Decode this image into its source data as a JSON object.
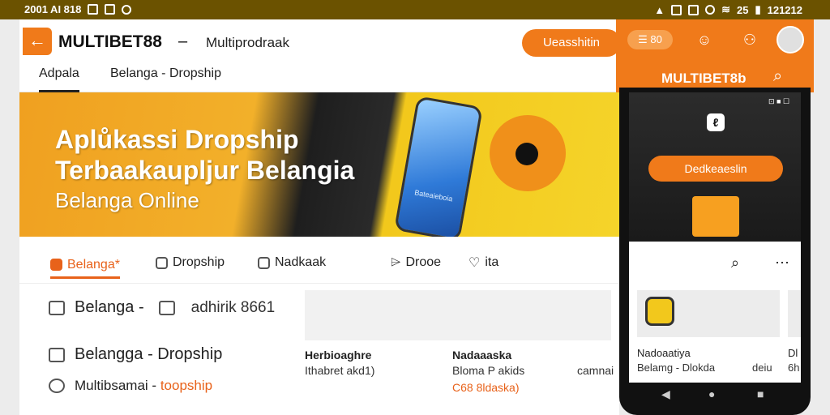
{
  "statusbar": {
    "left_text": "2001 AI 818",
    "right_text": "25",
    "time": "121212"
  },
  "header": {
    "back_label": "←",
    "brand": "MULTIBET88",
    "brand_sep": "–",
    "brand_sub": "Multiprodraak",
    "cta_label": "Ueasshitin",
    "tabs": [
      {
        "label": "Adpala"
      },
      {
        "label": "Belanga - Dropship"
      }
    ]
  },
  "hero": {
    "title_line1": "Aplůkassi Dropship",
    "title_line2": "Terbaakaupljur Belangia",
    "subtitle": "Belanga Online",
    "phone_label": "Bateaieboia"
  },
  "categories": [
    {
      "label": "Belanga*"
    },
    {
      "label": "Dropship"
    },
    {
      "label": "Nadkaak"
    },
    {
      "label": "Drooe"
    },
    {
      "label": "ita"
    }
  ],
  "list": [
    {
      "label": "Belanga -",
      "aux": "adhirik 8661"
    },
    {
      "label": "Belangga - Dropship"
    },
    {
      "label_main": "Multibsamai - ",
      "label_accent": "toopship"
    }
  ],
  "products": [
    {
      "title": "Herbioaghre",
      "sub": "Ithabret akd1)",
      "price": ""
    },
    {
      "title": "Nadaaaska",
      "sub": "Bloma P akids",
      "aux": "camnai",
      "price": "C68 8ldaska)"
    }
  ],
  "right_panel": {
    "menu_label": "☰ 80",
    "title": "MULTIBET8b",
    "icons": [
      "group-icon",
      "person-alert-icon",
      "avatar",
      "search-icon"
    ]
  },
  "phone": {
    "status": "⊡ ■ ☐",
    "logo": "ℓ",
    "cta_label": "Dedkeaeslin",
    "card": {
      "title": "Nadoaatiya",
      "sub": "Belamg - Dlokda",
      "aux": "deiu"
    },
    "card2": {
      "title": "Dl",
      "sub": "6h"
    }
  },
  "colors": {
    "accent": "#f07a1a",
    "statusbar": "#6b5200",
    "active_tab": "#e8621a"
  }
}
